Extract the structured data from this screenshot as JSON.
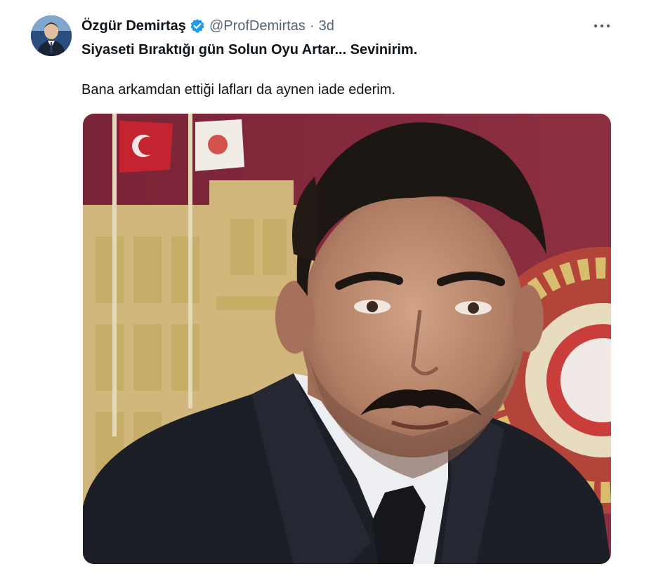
{
  "tweet": {
    "author_name": "Özgür Demirtaş",
    "handle": "@ProfDemirtas",
    "separator": "·",
    "timestamp": "3d",
    "text_line1": "Siyaseti Bıraktığı gün Solun Oyu Artar... Sevinirim.",
    "text_line2": "Bana arkamdan ettiği lafları da aynen iade ederim.",
    "verified_icon": "verified-badge-icon",
    "more_icon": "more-options-icon"
  },
  "colors": {
    "verified_blue": "#1d9bf0",
    "muted_text": "#536471",
    "backdrop_maroon": "#7e2a3c",
    "building_gold": "#d8c381"
  }
}
